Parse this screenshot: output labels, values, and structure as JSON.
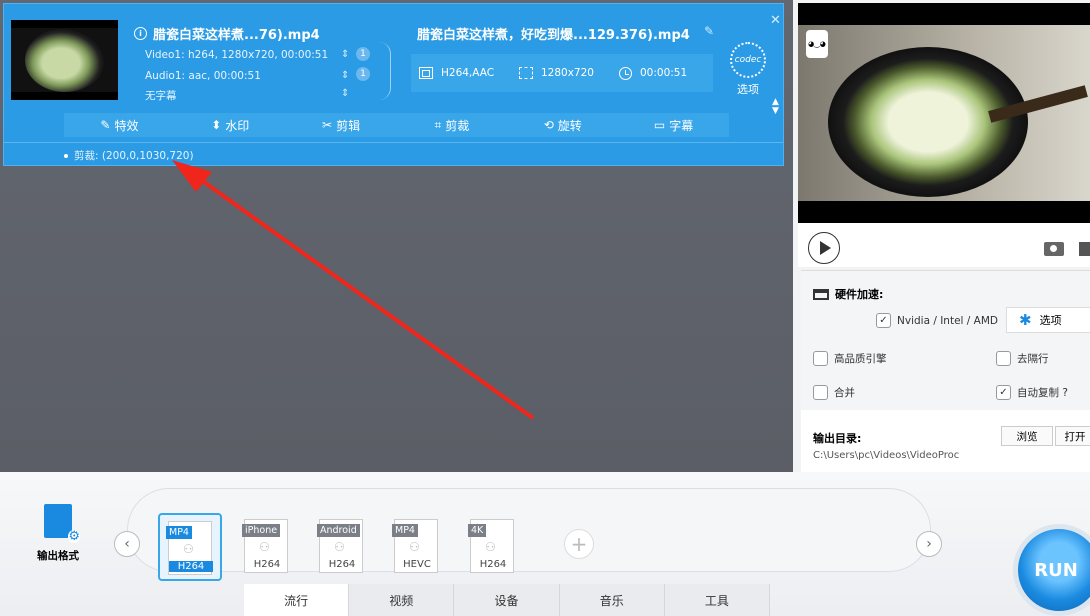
{
  "task": {
    "source_title": "腊瓷白菜这样煮...76).mp4",
    "video_stream": "Video1: h264, 1280x720, 00:00:51",
    "audio_stream": "Audio1: aac, 00:00:51",
    "subtitle_stream": "无字幕",
    "stream_index_1": "1",
    "stream_index_2": "1",
    "output_title": "腊瓷白菜这样煮，好吃到爆...129.376).mp4",
    "output_codec": "H264,AAC",
    "output_resolution": "1280x720",
    "output_duration": "00:00:51",
    "codec_icon_text": "codec",
    "codec_label": "选项",
    "crop_info": "剪裁: (200,0,1030,720)"
  },
  "toolbar": {
    "items": [
      {
        "icon": "magic-wand-icon",
        "glyph": "✎",
        "label": "特效"
      },
      {
        "icon": "watermark-icon",
        "glyph": "⬍",
        "label": "水印"
      },
      {
        "icon": "scissors-icon",
        "glyph": "✂",
        "label": "剪辑"
      },
      {
        "icon": "crop-icon",
        "glyph": "⌗",
        "label": "剪裁"
      },
      {
        "icon": "rotate-icon",
        "glyph": "⟲",
        "label": "旋转"
      },
      {
        "icon": "subtitle-icon",
        "glyph": "▭",
        "label": "字幕"
      }
    ]
  },
  "settings": {
    "hw_title": "硬件加速:",
    "nvidia_label": "Nvidia / Intel / AMD",
    "option_label": "选项",
    "high_quality_label": "高品质引擎",
    "deinterlace_label": "去隔行",
    "merge_label": "合并",
    "auto_copy_label": "自动复制 ?",
    "nvidia_checked": "✓",
    "auto_copy_checked": "✓"
  },
  "output": {
    "dir_label": "输出目录:",
    "path": "C:\\Users\\pc\\Videos\\VideoProc",
    "browse": "浏览",
    "open": "打开"
  },
  "bottom": {
    "out_format_label": "输出格式",
    "formats": [
      {
        "top": "MP4",
        "bottom": "H264",
        "selected": true
      },
      {
        "top": "iPhone",
        "bottom": "H264",
        "selected": false
      },
      {
        "top": "Android",
        "bottom": "H264",
        "selected": false
      },
      {
        "top": "MP4",
        "bottom": "HEVC",
        "selected": false
      },
      {
        "top": "4K",
        "bottom": "H264",
        "selected": false
      }
    ],
    "tabs": [
      "流行",
      "视频",
      "设备",
      "音乐",
      "工具"
    ],
    "run": "RUN"
  },
  "colors": {
    "accent": "#1a8ae0",
    "card": "#2a9be4",
    "arrow": "#f0261c"
  }
}
